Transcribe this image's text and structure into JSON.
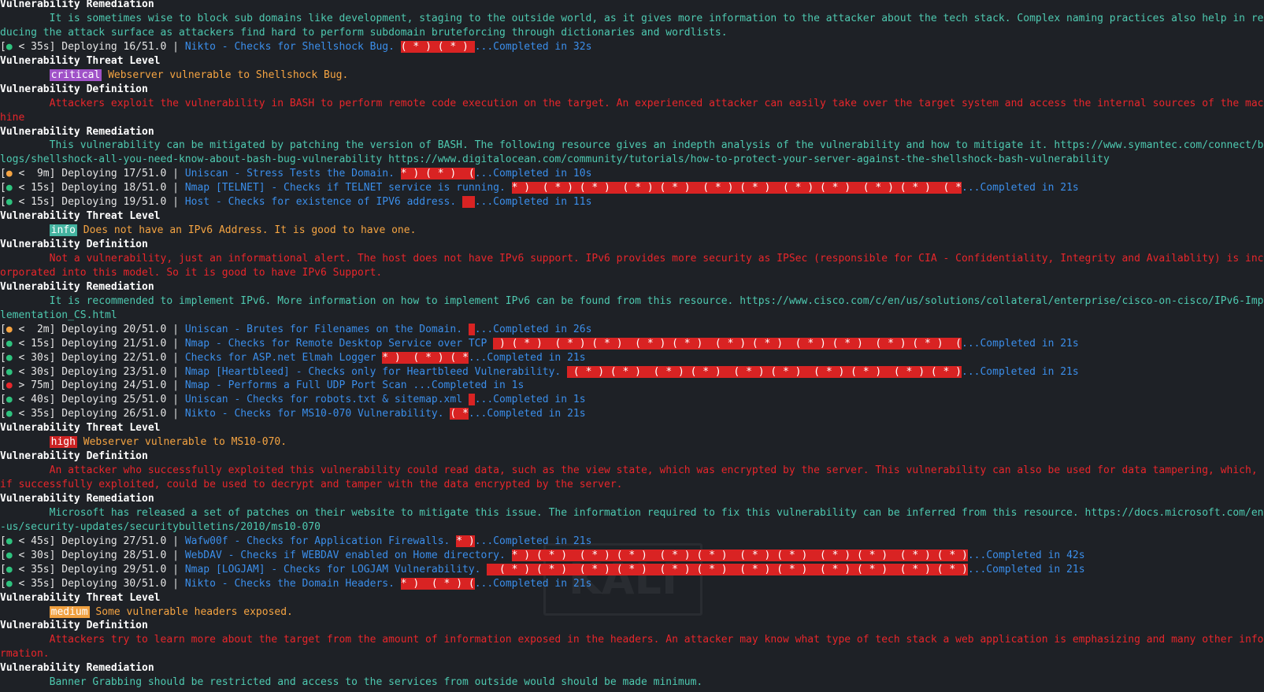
{
  "labels": {
    "remediation": "Vulnerability Remediation",
    "threat_level": "Vulnerability Threat Level",
    "definition": "Vulnerability Definition"
  },
  "watermark": "KALI",
  "entries": [
    {
      "type": "header",
      "label": "Vulnerability Remediation"
    },
    {
      "type": "text",
      "style": "cyan",
      "text": "        It is sometimes wise to block sub domains like development, staging to the outside world, as it gives more information to the attacker about the tech stack. Complex naming practices also help in reducing the attack surface as attackers find hard to perform subdomain bruteforcing through dictionaries and wordlists."
    },
    {
      "type": "task",
      "dot": "green",
      "time": " < 35s",
      "step": "16/51.0",
      "name": "Nikto - Checks for Shellshock Bug. ",
      "bar": "( * ) ( * ) ",
      "result": "...Completed in 32s"
    },
    {
      "type": "header",
      "label": "Vulnerability Threat Level"
    },
    {
      "type": "level",
      "severity": "critical",
      "badge": "critical",
      "message": "Webserver vulnerable to Shellshock Bug."
    },
    {
      "type": "header",
      "label": "Vulnerability Definition"
    },
    {
      "type": "text",
      "style": "red",
      "text": "        Attackers exploit the vulnerability in BASH to perform remote code execution on the target. An experienced attacker can easily take over the target system and access the internal sources of the machine"
    },
    {
      "type": "header",
      "label": "Vulnerability Remediation"
    },
    {
      "type": "text",
      "style": "cyan",
      "text": "        This vulnerability can be mitigated by patching the version of BASH. The following resource gives an indepth analysis of the vulnerability and how to mitigate it. https://www.symantec.com/connect/blogs/shellshock-all-you-need-know-about-bash-bug-vulnerability https://www.digitalocean.com/community/tutorials/how-to-protect-your-server-against-the-shellshock-bash-vulnerability"
    },
    {
      "type": "task",
      "dot": "orange",
      "time": " <  9m",
      "step": "17/51.0",
      "name": "Uniscan - Stress Tests the Domain. ",
      "bar": "* ) ( * )  (",
      "result": "...Completed in 10s"
    },
    {
      "type": "task",
      "dot": "green",
      "time": " < 15s",
      "step": "18/51.0",
      "name": "Nmap [TELNET] - Checks if TELNET service is running. ",
      "bar": "* )  ( * ) ( * )  ( * ) ( * )  ( * ) ( * )  ( * ) ( * )  ( * ) ( * )  ( *",
      "result": "...Completed in 21s"
    },
    {
      "type": "task",
      "dot": "green",
      "time": " < 15s",
      "step": "19/51.0",
      "name": "Host - Checks for existence of IPV6 address. ",
      "bar": "  ",
      "result": "...Completed in 11s"
    },
    {
      "type": "header",
      "label": "Vulnerability Threat Level"
    },
    {
      "type": "level",
      "severity": "info",
      "badge": "info",
      "message": "Does not have an IPv6 Address. It is good to have one."
    },
    {
      "type": "header",
      "label": "Vulnerability Definition"
    },
    {
      "type": "text",
      "style": "red",
      "text": "        Not a vulnerability, just an informational alert. The host does not have IPv6 support. IPv6 provides more security as IPSec (responsible for CIA - Confidentiality, Integrity and Availablity) is incorporated into this model. So it is good to have IPv6 Support."
    },
    {
      "type": "header",
      "label": "Vulnerability Remediation"
    },
    {
      "type": "text",
      "style": "cyan",
      "text": "        It is recommended to implement IPv6. More information on how to implement IPv6 can be found from this resource. https://www.cisco.com/c/en/us/solutions/collateral/enterprise/cisco-on-cisco/IPv6-Implementation_CS.html"
    },
    {
      "type": "task",
      "dot": "orange",
      "time": " <  2m",
      "step": "20/51.0",
      "name": "Uniscan - Brutes for Filenames on the Domain. ",
      "bar": " ",
      "result": "...Completed in 26s"
    },
    {
      "type": "task",
      "dot": "green",
      "time": " < 15s",
      "step": "21/51.0",
      "name": "Nmap - Checks for Remote Desktop Service over TCP ",
      "bar": " ) ( * )  ( * ) ( * )  ( * ) ( * )  ( * ) ( * )  ( * ) ( * )  ( * ) ( * )  (",
      "result": "...Completed in 21s"
    },
    {
      "type": "task",
      "dot": "green",
      "time": " < 30s",
      "step": "22/51.0",
      "name": "Checks for ASP.net Elmah Logger ",
      "bar": "* )  ( * ) ( *",
      "result": "...Completed in 21s"
    },
    {
      "type": "task",
      "dot": "green",
      "time": " < 30s",
      "step": "23/51.0",
      "name": "Nmap [Heartbleed] - Checks only for Heartbleed Vulnerability. ",
      "bar": " ( * ) ( * )  ( * ) ( * )  ( * ) ( * )  ( * ) ( * )  ( * ) ( * )",
      "result": "...Completed in 21s"
    },
    {
      "type": "task",
      "dot": "red",
      "time": " > 75m",
      "step": "24/51.0",
      "name": "Nmap - Performs a Full UDP Port Scan ",
      "bar": "",
      "result": "...Completed in 1s"
    },
    {
      "type": "task",
      "dot": "green",
      "time": " < 40s",
      "step": "25/51.0",
      "name": "Uniscan - Checks for robots.txt & sitemap.xml ",
      "bar": " ",
      "result": "...Completed in 1s"
    },
    {
      "type": "task",
      "dot": "green",
      "time": " < 35s",
      "step": "26/51.0",
      "name": "Nikto - Checks for MS10-070 Vulnerability. ",
      "bar": "( *",
      "result": "...Completed in 21s"
    },
    {
      "type": "header",
      "label": "Vulnerability Threat Level"
    },
    {
      "type": "level",
      "severity": "high",
      "badge": "high",
      "message": "Webserver vulnerable to MS10-070."
    },
    {
      "type": "header",
      "label": "Vulnerability Definition"
    },
    {
      "type": "text",
      "style": "red",
      "text": "        An attacker who successfully exploited this vulnerability could read data, such as the view state, which was encrypted by the server. This vulnerability can also be used for data tampering, which, if successfully exploited, could be used to decrypt and tamper with the data encrypted by the server."
    },
    {
      "type": "header",
      "label": "Vulnerability Remediation"
    },
    {
      "type": "text",
      "style": "cyan",
      "text": "        Microsoft has released a set of patches on their website to mitigate this issue. The information required to fix this vulnerability can be inferred from this resource. https://docs.microsoft.com/en-us/security-updates/securitybulletins/2010/ms10-070"
    },
    {
      "type": "task",
      "dot": "green",
      "time": " < 45s",
      "step": "27/51.0",
      "name": "Wafw00f - Checks for Application Firewalls. ",
      "bar": "* )",
      "result": "...Completed in 21s"
    },
    {
      "type": "task",
      "dot": "green",
      "time": " < 30s",
      "step": "28/51.0",
      "name": "WebDAV - Checks if WEBDAV enabled on Home directory. ",
      "bar": "* ) ( * )  ( * ) ( * )  ( * ) ( * )  ( * ) ( * )  ( * ) ( * )  ( * ) ( * )",
      "result": "...Completed in 42s"
    },
    {
      "type": "task",
      "dot": "green",
      "time": " < 35s",
      "step": "29/51.0",
      "name": "Nmap [LOGJAM] - Checks for LOGJAM Vulnerability. ",
      "bar": "  ( * ) ( * )  ( * ) ( * )  ( * ) ( * )  ( * ) ( * )  ( * ) ( * )  ( * ) ( * )",
      "result": "...Completed in 21s"
    },
    {
      "type": "task",
      "dot": "green",
      "time": " < 35s",
      "step": "30/51.0",
      "name": "Nikto - Checks the Domain Headers. ",
      "bar": "* )  ( * ) (",
      "result": "...Completed in 21s"
    },
    {
      "type": "header",
      "label": "Vulnerability Threat Level"
    },
    {
      "type": "level",
      "severity": "medium",
      "badge": "medium",
      "message": "Some vulnerable headers exposed."
    },
    {
      "type": "header",
      "label": "Vulnerability Definition"
    },
    {
      "type": "text",
      "style": "red",
      "text": "        Attackers try to learn more about the target from the amount of information exposed in the headers. An attacker may know what type of tech stack a web application is emphasizing and many other information."
    },
    {
      "type": "header",
      "label": "Vulnerability Remediation"
    },
    {
      "type": "text",
      "style": "cyan",
      "text": "        Banner Grabbing should be restricted and access to the services from outside would should be made minimum."
    }
  ],
  "colors": {
    "background": "#1e2126",
    "cyan": "#4ec9b0",
    "red": "#e8262b",
    "blue": "#3b8eea",
    "orange": "#f5a442",
    "bar": "#d92323",
    "critical": "#a052c8",
    "info": "#44b3a0",
    "high": "#cc2222",
    "medium": "#f0a040"
  }
}
